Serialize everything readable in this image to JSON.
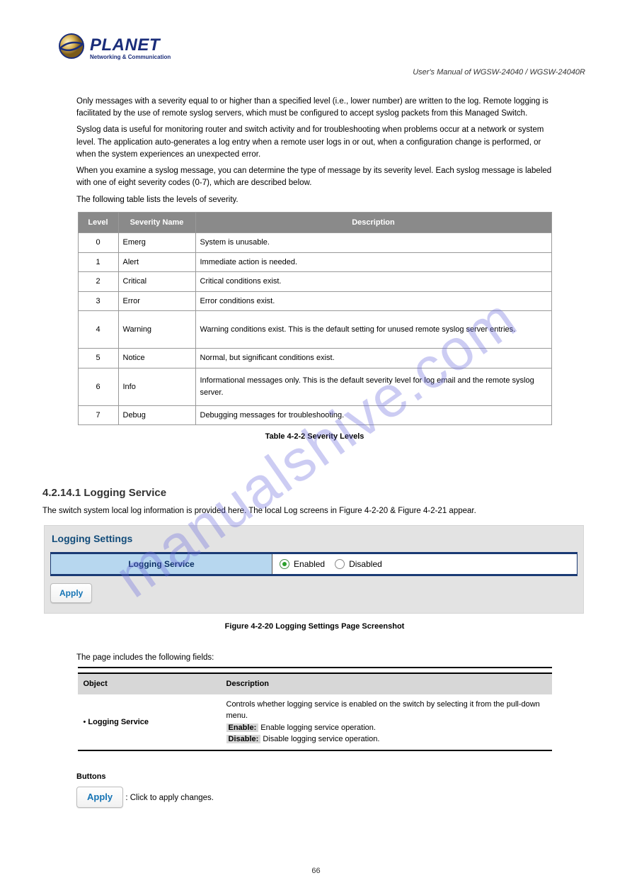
{
  "watermark": "manualshive.com",
  "brand": {
    "name": "PLANET",
    "tagline": "Networking & Communication"
  },
  "header": {
    "manual": "User's Manual of WGSW-24040 / WGSW-24040R"
  },
  "intro": {
    "p1": "Only messages with a severity equal to or higher than a specified level (i.e., lower number) are written to the log. Remote logging is facilitated by the use of remote syslog servers, which must be configured to accept syslog packets from this Managed Switch.",
    "p2": "Syslog data is useful for monitoring router and switch activity and for troubleshooting when problems occur at a network or system level. The application auto-generates a log entry when a remote user logs in or out, when a configuration change is performed, or when the system experiences an unexpected error.",
    "p3": "When you examine a syslog message, you can determine the type of message by its severity level. Each syslog message is labeled with one of eight severity codes (0-7), which are described below.",
    "p4": "The following table lists the levels of severity."
  },
  "severity": {
    "headers": [
      "Level",
      "Severity Name",
      "Description"
    ],
    "rows": [
      {
        "level": "0",
        "name": "Emerg",
        "desc": "System is unusable."
      },
      {
        "level": "1",
        "name": "Alert",
        "desc": "Immediate action is needed."
      },
      {
        "level": "2",
        "name": "Critical",
        "desc": "Critical conditions exist."
      },
      {
        "level": "3",
        "name": "Error",
        "desc": "Error conditions exist."
      },
      {
        "level": "4",
        "name": "Warning",
        "desc": "Warning conditions exist. This is the default setting for unused remote syslog server entries."
      },
      {
        "level": "5",
        "name": "Notice",
        "desc": "Normal, but significant conditions exist."
      },
      {
        "level": "6",
        "name": "Info",
        "desc": "Informational messages only. This is the default severity level for log email and the remote syslog server."
      },
      {
        "level": "7",
        "name": "Debug",
        "desc": "Debugging messages for troubleshooting."
      }
    ],
    "caption": "Table 4-2-2 Severity Levels"
  },
  "logsetting": {
    "heading": "4.2.14.1 Logging Service",
    "desc": "The switch system local log information is provided here. The local Log screens in Figure 4-2-20 & Figure 4-2-21 appear."
  },
  "panel": {
    "title": "Logging Settings",
    "label": "Logging Service",
    "opt1": "Enabled",
    "opt2": "Disabled",
    "apply": "Apply",
    "caption": "Figure 4-2-20 Logging Settings Page Screenshot"
  },
  "fields": {
    "intro": "The page includes the following fields:",
    "headers": [
      "Object",
      "Description"
    ],
    "rows": [
      {
        "obj": "Logging Service",
        "d1": "Controls whether logging service is enabled on the switch by selecting it from the pull-down menu.",
        "opt1": "Enable:",
        "d2": " Enable logging service operation.",
        "opt2": "Disable:",
        "d3": " Disable logging service operation."
      }
    ]
  },
  "buttons": {
    "label": "Buttons",
    "apply": "Apply",
    "desc": " : Click to apply changes."
  },
  "footer": {
    "page": "66"
  }
}
